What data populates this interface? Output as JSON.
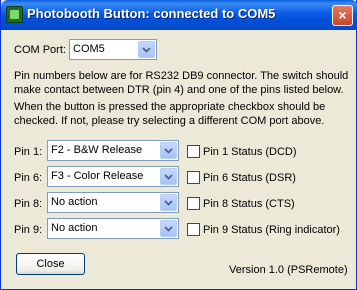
{
  "window": {
    "title": "Photobooth Button: connected to COM5",
    "close_glyph": "×"
  },
  "com_port": {
    "label": "COM Port:",
    "value": "COM5"
  },
  "info": {
    "paragraph1": "Pin numbers below are for RS232 DB9 connector. The switch should make contact between DTR (pin 4) and one of the pins listed below.",
    "paragraph2": "When the button is pressed the appropriate checkbox should be checked. If not, please try selecting a different COM port above."
  },
  "pins": [
    {
      "label": "Pin 1:",
      "action": "F2 - B&W Release",
      "status": "Pin 1 Status (DCD)",
      "checked": false
    },
    {
      "label": "Pin 6:",
      "action": "F3 - Color Release",
      "status": "Pin 6 Status (DSR)",
      "checked": false
    },
    {
      "label": "Pin 8:",
      "action": "No action",
      "status": "Pin 8 Status (CTS)",
      "checked": false
    },
    {
      "label": "Pin 9:",
      "action": "No action",
      "status": "Pin 9 Status (Ring indicator)",
      "checked": false
    }
  ],
  "footer": {
    "close_label": "Close",
    "version": "Version 1.0 (PSRemote)"
  },
  "icons": {
    "title": "app-icon",
    "dropdown": "chevron-down-icon"
  }
}
